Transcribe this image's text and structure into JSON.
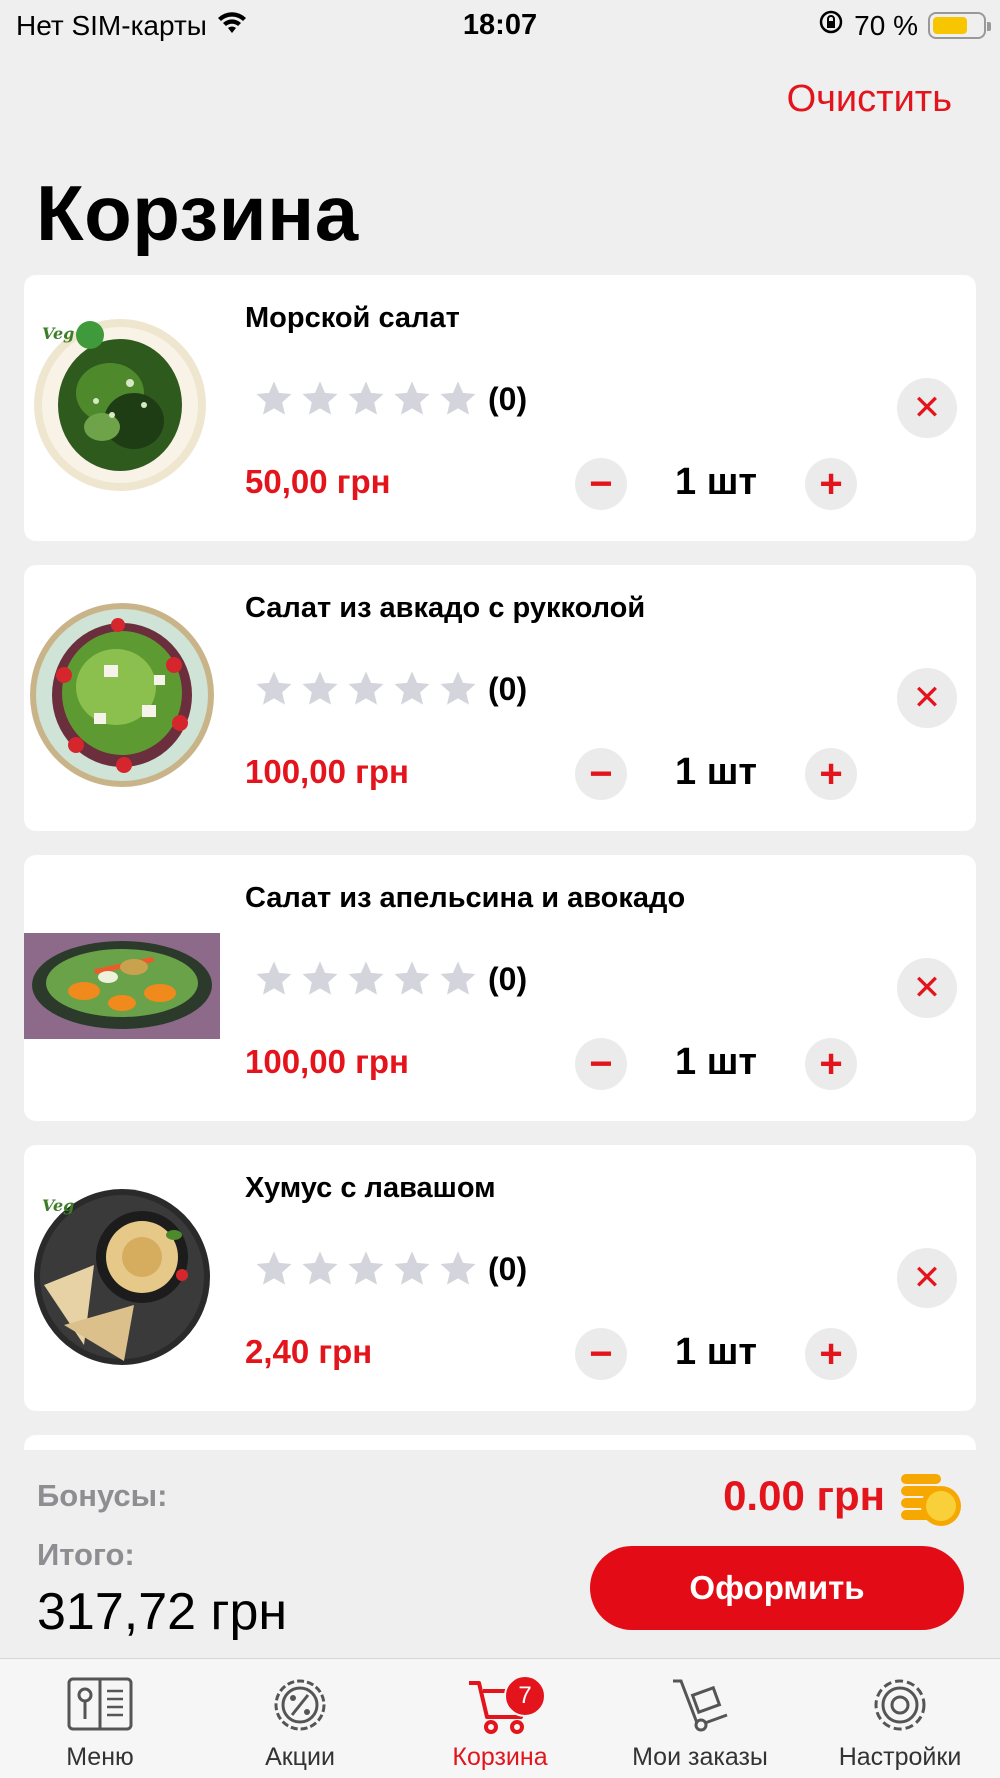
{
  "status_bar": {
    "carrier": "Нет SIM-карты",
    "time": "18:07",
    "battery": "70 %",
    "battery_level": 0.7
  },
  "header": {
    "clear_label": "Очистить",
    "title": "Корзина"
  },
  "cart": {
    "items": [
      {
        "name": "Морской салат",
        "rating_count": "(0)",
        "price": "50,00 грн",
        "quantity": "1 шт",
        "rating": 0,
        "image": "sea-salad-image"
      },
      {
        "name": "Салат из авкадо с рукколой",
        "rating_count": "(0)",
        "price": "100,00 грн",
        "quantity": "1 шт",
        "rating": 0,
        "image": "avocado-arugula-salad-image"
      },
      {
        "name": "Салат из апельсина и авокадо",
        "rating_count": "(0)",
        "price": "100,00 грн",
        "quantity": "1 шт",
        "rating": 0,
        "image": "orange-avocado-salad-image"
      },
      {
        "name": "Хумус с лавашом",
        "rating_count": "(0)",
        "price": "2,40 грн",
        "quantity": "1 шт",
        "rating": 0,
        "image": "hummus-lavash-image"
      }
    ],
    "qty_minus": "−",
    "qty_plus": "+",
    "remove": "✕"
  },
  "summary": {
    "bonus_label": "Бонусы:",
    "bonus_value": "0.00 грн",
    "total_label": "Итого:",
    "total_value": "317,72 грн",
    "checkout_label": "Оформить"
  },
  "tabs": [
    {
      "label": "Меню",
      "icon": "menu-book-icon"
    },
    {
      "label": "Акции",
      "icon": "discount-gear-icon"
    },
    {
      "label": "Корзина",
      "icon": "cart-icon",
      "badge": "7",
      "active": true
    },
    {
      "label": "Мои заказы",
      "icon": "hand-truck-icon"
    },
    {
      "label": "Настройки",
      "icon": "settings-gear-icon"
    }
  ],
  "colors": {
    "accent": "#e3141b",
    "background": "#efeff0",
    "muted": "#8e8e92",
    "star": "#d4d4dc"
  }
}
